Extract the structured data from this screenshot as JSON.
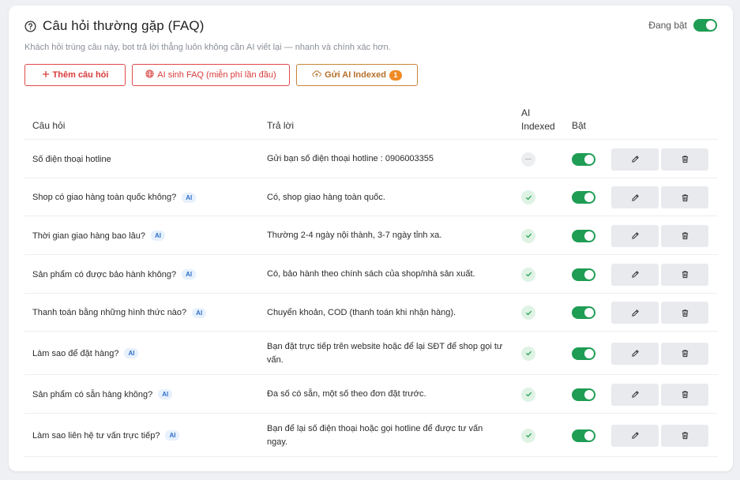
{
  "header": {
    "title": "Câu hỏi thường gặp (FAQ)",
    "toggle_label": "Đang bật",
    "subtitle": "Khách hỏi trúng câu này, bot trả lời thẳng luôn không cần AI viết lại — nhanh và chính xác hơn."
  },
  "actions": {
    "add_label": "Thêm câu hỏi",
    "ai_label": "AI sinh FAQ (miễn phí lần đầu)",
    "send_label": "Gửi AI Indexed",
    "send_count": "1"
  },
  "table": {
    "col_question": "Câu hỏi",
    "col_answer": "Trả lời",
    "col_ai_1": "AI",
    "col_ai_2": "Indexed",
    "col_on": "Bật",
    "ai_tag": "AI",
    "rows": [
      {
        "question": "Số điện thoại hotline",
        "answer": "Gửi bạn số điện thoại hotline : 0906003355",
        "ai": false,
        "indexed": false,
        "enabled": true
      },
      {
        "question": "Shop có giao hàng toàn quốc không?",
        "answer": "Có, shop giao hàng toàn quốc.",
        "ai": true,
        "indexed": true,
        "enabled": true
      },
      {
        "question": "Thời gian giao hàng bao lâu?",
        "answer": "Thường 2-4 ngày nội thành, 3-7 ngày tỉnh xa.",
        "ai": true,
        "indexed": true,
        "enabled": true
      },
      {
        "question": "Sản phẩm có được bảo hành không?",
        "answer": "Có, bảo hành theo chính sách của shop/nhà sản xuất.",
        "ai": true,
        "indexed": true,
        "enabled": true
      },
      {
        "question": "Thanh toán bằng những hình thức nào?",
        "answer": "Chuyển khoản, COD (thanh toán khi nhận hàng).",
        "ai": true,
        "indexed": true,
        "enabled": true
      },
      {
        "question": "Làm sao để đặt hàng?",
        "answer": "Bạn đặt trực tiếp trên website hoặc để lại SĐT để shop gọi tư vấn.",
        "ai": true,
        "indexed": true,
        "enabled": true
      },
      {
        "question": "Sản phẩm có sẵn hàng không?",
        "answer": "Đa số có sẵn, một số theo đơn đặt trước.",
        "ai": true,
        "indexed": true,
        "enabled": true
      },
      {
        "question": "Làm sao liên hệ tư vấn trực tiếp?",
        "answer": "Bạn để lại số điện thoại hoặc gọi hotline để được tư vấn ngay.",
        "ai": true,
        "indexed": true,
        "enabled": true
      }
    ]
  },
  "colors": {
    "accent_red": "#e24a4a",
    "accent_orange": "#f08a24",
    "toggle_green": "#1f9d55",
    "ai_tag_blue": "#2f6fc9"
  },
  "icons": {
    "title": "question-circle-icon",
    "add": "plus-icon",
    "ai": "globe-icon",
    "send": "upload-cloud-icon",
    "edit": "pencil-icon",
    "delete": "trash-icon",
    "indexed": "check-circle-icon",
    "not_indexed": "dash-circle-icon"
  }
}
